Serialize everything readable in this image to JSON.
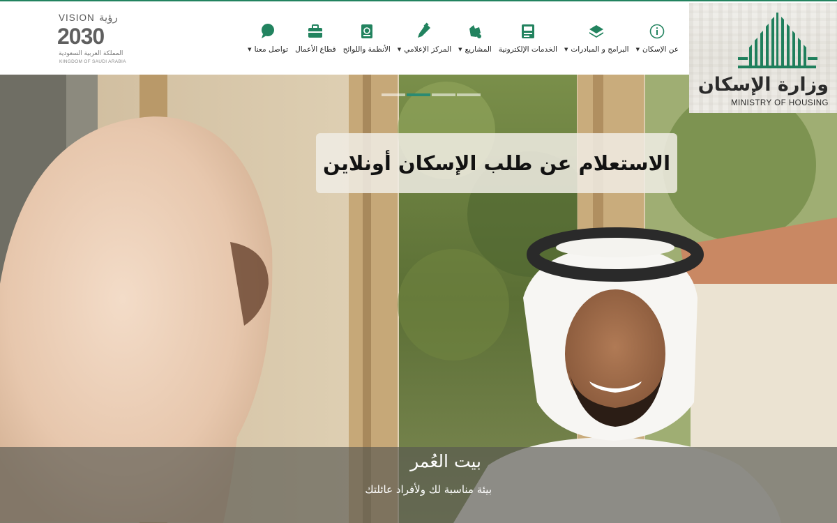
{
  "header": {
    "ministry_logo": {
      "arabic_name": "وزارة الإسكان",
      "english_name": "MINISTRY OF HOUSING",
      "icon": "housing-ministry-emblem"
    },
    "vision_logo": {
      "title_en": "VISION",
      "title_ar": "رؤية",
      "year": "2030",
      "kingdom_ar": "المملكة العربية السعودية",
      "kingdom_en": "KINGDOM OF SAUDI ARABIA"
    },
    "nav": [
      {
        "label": "عن الإسكان",
        "icon": "info-icon",
        "dropdown": true
      },
      {
        "label": "البرامج و المبادرات",
        "icon": "layers-icon",
        "dropdown": true
      },
      {
        "label": "الخدمات الإلكترونية",
        "icon": "eservices-icon",
        "dropdown": false
      },
      {
        "label": "المشاريع",
        "icon": "projects-icon",
        "dropdown": true
      },
      {
        "label": "المركز الإعلامي",
        "icon": "pen-icon",
        "dropdown": true
      },
      {
        "label": "الأنظمة واللوائح",
        "icon": "regulations-icon",
        "dropdown": false
      },
      {
        "label": "قطاع الأعمال",
        "icon": "briefcase-icon",
        "dropdown": false
      },
      {
        "label": "تواصل معنا",
        "icon": "chat-icon",
        "dropdown": true
      }
    ],
    "caret": "▼"
  },
  "hero": {
    "headline": "الاستعلام عن طلب الإسكان أونلاين",
    "slides": 4,
    "active_slide": 2,
    "caption_title": "بيت العُمر",
    "caption_subtitle": "بيئة مناسبة لك ولأفراد عائلتك"
  },
  "colors": {
    "brand_green": "#22835f",
    "slider_active": "#2a8b72",
    "nav_icon": "#22835f"
  }
}
